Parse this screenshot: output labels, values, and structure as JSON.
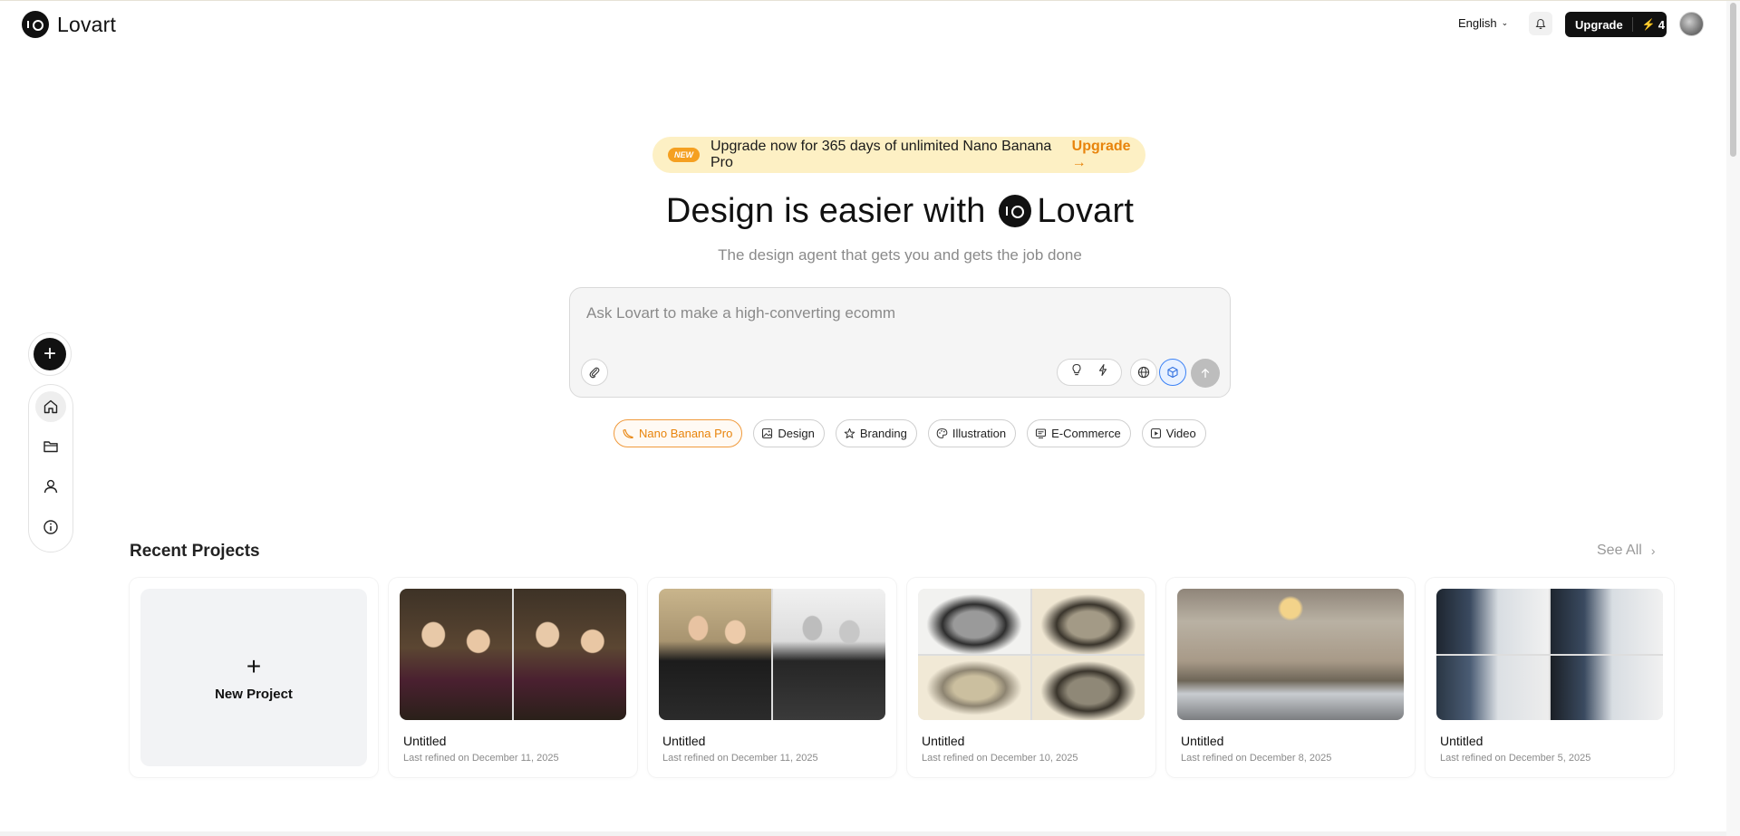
{
  "header": {
    "brand": "Lovart",
    "language": "English",
    "upgrade_label": "Upgrade",
    "credits": "4"
  },
  "rail": {
    "items": [
      "home",
      "projects",
      "profile",
      "info"
    ]
  },
  "promo": {
    "badge": "NEW",
    "text": "Upgrade now for 365 days of unlimited Nano Banana Pro",
    "link": "Upgrade →"
  },
  "hero": {
    "title_prefix": "Design is easier with",
    "title_brand": "Lovart",
    "subtitle": "The design agent that gets you and gets the job done"
  },
  "prompt": {
    "placeholder": "Ask Lovart to make a high-converting ecomm"
  },
  "chips": [
    {
      "label": "Nano Banana Pro",
      "icon": "banana-icon"
    },
    {
      "label": "Design",
      "icon": "image-icon"
    },
    {
      "label": "Branding",
      "icon": "star-icon"
    },
    {
      "label": "Illustration",
      "icon": "palette-icon"
    },
    {
      "label": "E-Commerce",
      "icon": "storefront-icon"
    },
    {
      "label": "Video",
      "icon": "play-icon"
    }
  ],
  "recent": {
    "title": "Recent Projects",
    "see_all": "See All",
    "new_project": "New Project",
    "projects": [
      {
        "title": "Untitled",
        "date": "Last refined on December 11, 2025"
      },
      {
        "title": "Untitled",
        "date": "Last refined on December 11, 2025"
      },
      {
        "title": "Untitled",
        "date": "Last refined on December 10, 2025"
      },
      {
        "title": "Untitled",
        "date": "Last refined on December 8, 2025"
      },
      {
        "title": "Untitled",
        "date": "Last refined on December 5, 2025"
      }
    ]
  },
  "colors": {
    "accent": "#e8840c",
    "promo_bg": "#fdf0c4",
    "primary": "#111111"
  }
}
